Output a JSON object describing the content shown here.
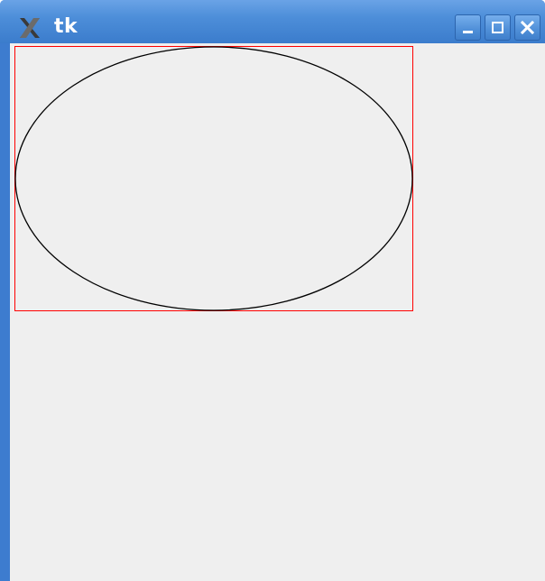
{
  "window": {
    "title": "tk",
    "app_icon": "x-logo-icon",
    "controls": {
      "minimize_icon": "minimize-icon",
      "maximize_icon": "maximize-icon",
      "close_icon": "close-icon"
    }
  },
  "canvas": {
    "background": "#efefef",
    "shapes": [
      {
        "type": "rectangle",
        "outline": "#ff0000"
      },
      {
        "type": "oval",
        "outline": "#000000"
      }
    ]
  },
  "colors": {
    "titlebar": "#4d8ed9",
    "frame": "#3d7ccf",
    "title_text": "#ffffff"
  }
}
